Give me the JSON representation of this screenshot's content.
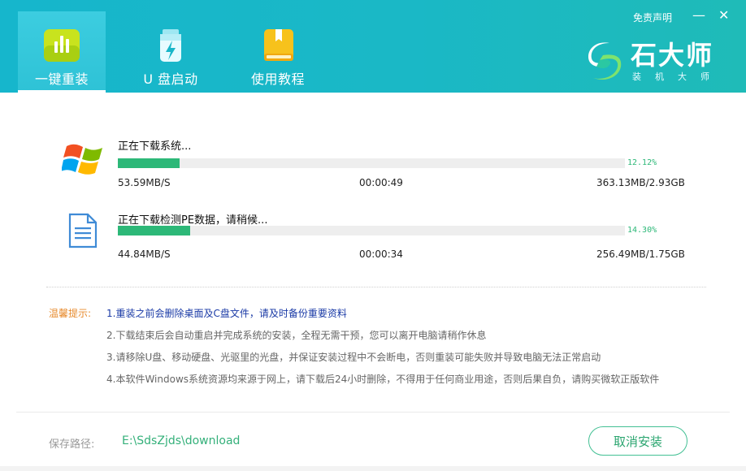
{
  "header": {
    "tabs": [
      {
        "label": "一键重装",
        "icon": "bar-chart-icon",
        "active": true
      },
      {
        "label": "U 盘启动",
        "icon": "usb-lightning-icon",
        "active": false
      },
      {
        "label": "使用教程",
        "icon": "book-icon",
        "active": false
      }
    ],
    "disclaimer": "免责声明",
    "minimize": "—",
    "close": "✕",
    "brand": {
      "title": "石大师",
      "subtitle": "装机大师",
      "icon": "logo-swirl-icon"
    }
  },
  "downloads": [
    {
      "icon": "windows-logo-icon",
      "title": "正在下载系统...",
      "percent_text": "12.12%",
      "progress": 0.1212,
      "speed": "53.59MB/S",
      "time": "00:00:49",
      "size": "363.13MB/2.93GB"
    },
    {
      "icon": "document-icon",
      "title": "正在下载检测PE数据，请稍候...",
      "percent_text": "14.30%",
      "progress": 0.143,
      "speed": "44.84MB/S",
      "time": "00:00:34",
      "size": "256.49MB/1.75GB"
    }
  ],
  "tips": {
    "label": "温馨提示:",
    "items": [
      "1.重装之前会删除桌面及C盘文件，请及时备份重要资料",
      "2.下载结束后会自动重启并完成系统的安装，全程无需干预，您可以离开电脑请稍作休息",
      "3.请移除U盘、移动硬盘、光驱里的光盘，并保证安装过程中不会断电，否则重装可能失败并导致电脑无法正常启动",
      "4.本软件Windows系统资源均来源于网上，请下载后24小时删除，不得用于任何商业用途，否则后果自负，请购买微软正版软件"
    ]
  },
  "footer": {
    "path_label": "保存路径:",
    "path_value": "E:\\SdsZjds\\download",
    "cancel_label": "取消安装"
  },
  "colors": {
    "header": "#1ab8c6",
    "progress": "#2db878",
    "tip_highlight": "#1a3aa6",
    "tip_label": "#e78a2c"
  }
}
